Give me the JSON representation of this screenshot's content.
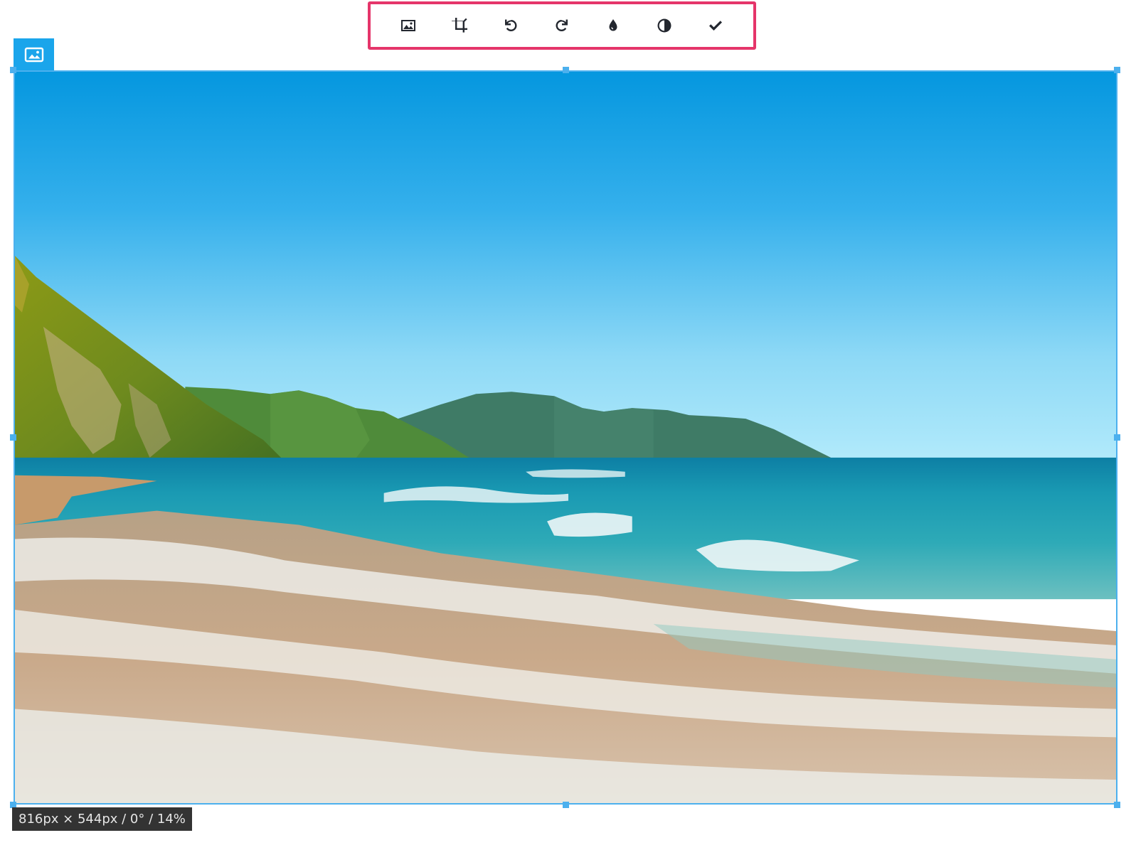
{
  "toolbar": {
    "buttons": [
      {
        "icon": "image-icon",
        "action": "replace-image"
      },
      {
        "icon": "crop-icon",
        "action": "crop"
      },
      {
        "icon": "rotate-left-icon",
        "action": "rotate-left"
      },
      {
        "icon": "rotate-right-icon",
        "action": "rotate-right"
      },
      {
        "icon": "drop-icon",
        "action": "blur"
      },
      {
        "icon": "contrast-icon",
        "action": "contrast"
      },
      {
        "icon": "check-icon",
        "action": "apply"
      }
    ],
    "highlight_color": "#e5356a"
  },
  "badge": {
    "icon": "image-icon",
    "color": "#1aa5eb"
  },
  "image": {
    "description_icon": "beach-photo",
    "frame_color": "#4cb0ee"
  },
  "info": {
    "text": "816px × 544px / 0° / 14%"
  }
}
